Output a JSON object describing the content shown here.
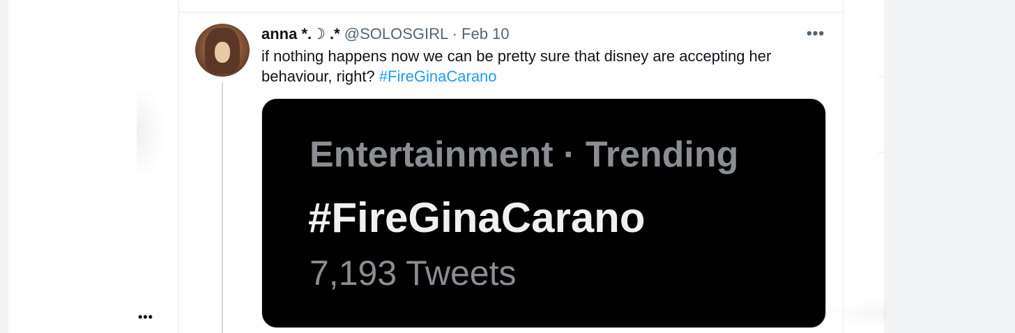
{
  "tweet": {
    "author_name": "anna *.☽ .*",
    "handle": "@SOLOSGIRL",
    "separator": "·",
    "date": "Feb 10",
    "more_label": "•••",
    "text_before": "if nothing happens now we can be pretty sure that disney are accepting her behaviour, right? ",
    "hashtag": "#FireGinaCarano",
    "media": {
      "category_line": "Entertainment · Trending",
      "trend_name": "#FireGinaCarano",
      "tweet_count": "7,193 Tweets"
    }
  },
  "side": {
    "more_label": "•••"
  },
  "colors": {
    "link": "#1d9bf0",
    "secondary_text": "#536471",
    "primary_text": "#0f1419",
    "border": "#e6ecf0"
  }
}
